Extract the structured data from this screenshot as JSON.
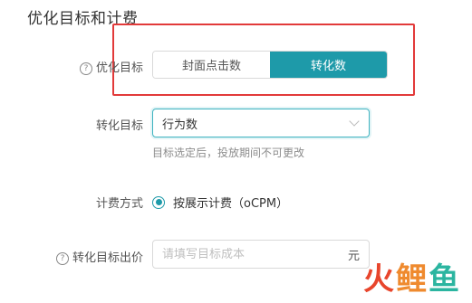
{
  "section": {
    "title": "优化目标和计费"
  },
  "optimization_target": {
    "label": "优化目标",
    "help_icon": "question-circle-icon",
    "options": [
      {
        "label": "封面点击数",
        "selected": false
      },
      {
        "label": "转化数",
        "selected": true
      }
    ],
    "accent_color": "#1e9aa9"
  },
  "conversion_target": {
    "label": "转化目标",
    "value": "行为数",
    "hint": "目标选定后，投放期间不可更改"
  },
  "billing": {
    "label": "计费方式",
    "option_label": "按展示计费（oCPM）",
    "selected": true
  },
  "bid": {
    "label": "转化目标出价",
    "help_icon": "question-circle-icon",
    "placeholder": "请填写目标成本",
    "unit": "元"
  },
  "watermark": {
    "text": "火鲤鱼",
    "colors": [
      "#e8452c",
      "#ef8a2e",
      "#2bb5a0"
    ]
  },
  "annotation": {
    "color": "#e23a3a"
  }
}
